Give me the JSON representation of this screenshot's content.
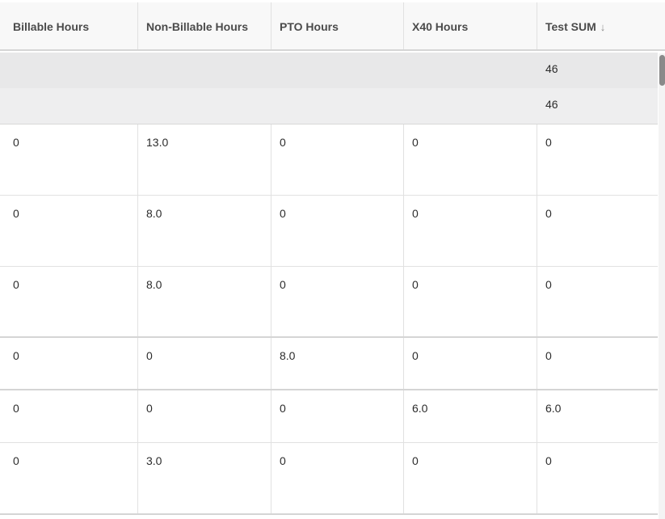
{
  "columns": [
    {
      "label": "Billable Hours"
    },
    {
      "label": "Non-Billable Hours"
    },
    {
      "label": "PTO Hours"
    },
    {
      "label": "X40 Hours"
    },
    {
      "label": "Test SUM"
    }
  ],
  "sort": {
    "column": "Test SUM",
    "direction": "descending",
    "icon": "arrow-down-icon"
  },
  "summary_rows": [
    {
      "test_sum": "46"
    },
    {
      "test_sum": "46"
    }
  ],
  "rows": [
    [
      "0",
      "13.0",
      "0",
      "0",
      "0"
    ],
    [
      "0",
      "8.0",
      "0",
      "0",
      "0"
    ],
    [
      "0",
      "8.0",
      "0",
      "0",
      "0"
    ],
    [
      "0",
      "0",
      "8.0",
      "0",
      "0"
    ],
    [
      "0",
      "0",
      "0",
      "6.0",
      "6.0"
    ],
    [
      "0",
      "3.0",
      "0",
      "0",
      "0"
    ]
  ]
}
